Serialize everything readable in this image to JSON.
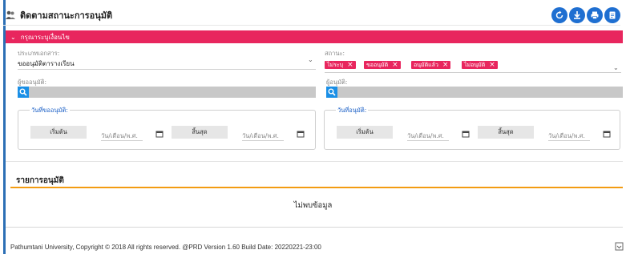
{
  "header": {
    "title": "ติดตามสถานะการอนุมัติ",
    "title_icon": "people-icon",
    "actions": [
      {
        "name": "refresh-icon"
      },
      {
        "name": "download-icon"
      },
      {
        "name": "print-icon"
      },
      {
        "name": "document-icon"
      }
    ]
  },
  "filter": {
    "band_label": "กรุณาระบุเงื่อนไข",
    "doc_type": {
      "label": "ประเภทเอกสาร:",
      "value": "ขออนุมัติตารางเรียน"
    },
    "status": {
      "label": "สถานะ:",
      "chips": [
        "ไม่ระบุ",
        "ขออนุมัติ",
        "อนุมัติแล้ว",
        "ไม่อนุมัติ"
      ]
    },
    "requester": {
      "label": "ผู้ขออนุมัติ:"
    },
    "approver": {
      "label": "ผู้อนุมัติ:"
    },
    "request_date": {
      "legend": "วันที่ขออนุมัติ:",
      "start": "เริ่มต้น",
      "end": "สิ้นสุด",
      "placeholder": "วัน/เดือน/พ.ศ."
    },
    "approve_date": {
      "legend": "วันที่อนุมัติ:",
      "start": "เริ่มต้น",
      "end": "สิ้นสุด",
      "placeholder": "วัน/เดือน/พ.ศ."
    }
  },
  "list": {
    "title": "รายการอนุมัติ",
    "empty": "ไม่พบข้อมูล"
  },
  "footer": {
    "text": "Pathumtani University, Copyright © 2018 All rights reserved. @PRD Version 1.60 Build Date: 20220221-23:00"
  },
  "colors": {
    "accent": "#e8265e",
    "primary": "#1f6fd1",
    "orange": "#f39c12"
  }
}
